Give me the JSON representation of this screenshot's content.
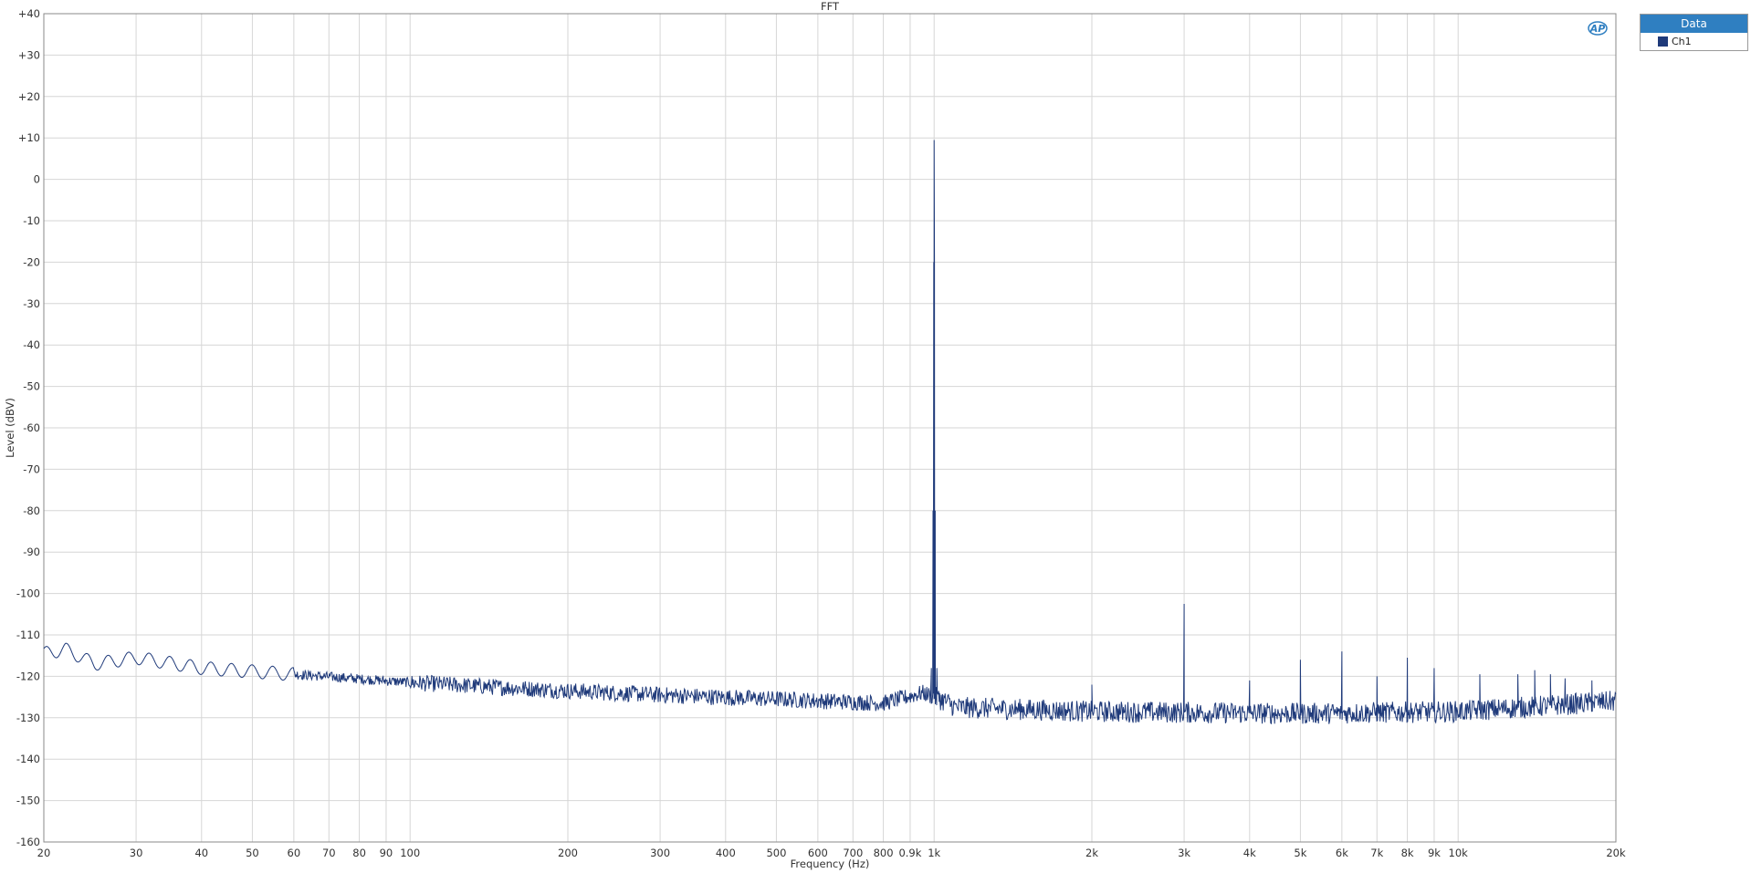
{
  "chart_data": {
    "type": "line",
    "title": "FFT",
    "xlabel": "Frequency (Hz)",
    "ylabel": "Level (dBV)",
    "x_scale": "log",
    "xlim": [
      20,
      20000
    ],
    "ylim": [
      -160,
      40
    ],
    "grid": true,
    "legend": {
      "title": "Data",
      "placement": "top-right-outside"
    },
    "x_ticks": [
      {
        "v": 20,
        "label": "20"
      },
      {
        "v": 30,
        "label": "30"
      },
      {
        "v": 40,
        "label": "40"
      },
      {
        "v": 50,
        "label": "50"
      },
      {
        "v": 60,
        "label": "60"
      },
      {
        "v": 70,
        "label": "70"
      },
      {
        "v": 80,
        "label": "80"
      },
      {
        "v": 90,
        "label": "90"
      },
      {
        "v": 100,
        "label": "100"
      },
      {
        "v": 200,
        "label": "200"
      },
      {
        "v": 300,
        "label": "300"
      },
      {
        "v": 400,
        "label": "400"
      },
      {
        "v": 500,
        "label": "500"
      },
      {
        "v": 600,
        "label": "600"
      },
      {
        "v": 700,
        "label": "700"
      },
      {
        "v": 800,
        "label": "800"
      },
      {
        "v": 900,
        "label": "0.9k"
      },
      {
        "v": 1000,
        "label": "1k"
      },
      {
        "v": 2000,
        "label": "2k"
      },
      {
        "v": 3000,
        "label": "3k"
      },
      {
        "v": 4000,
        "label": "4k"
      },
      {
        "v": 5000,
        "label": "5k"
      },
      {
        "v": 6000,
        "label": "6k"
      },
      {
        "v": 7000,
        "label": "7k"
      },
      {
        "v": 8000,
        "label": "8k"
      },
      {
        "v": 9000,
        "label": "9k"
      },
      {
        "v": 10000,
        "label": "10k"
      },
      {
        "v": 20000,
        "label": "20k"
      }
    ],
    "y_ticks": [
      {
        "v": 40,
        "label": "+40"
      },
      {
        "v": 30,
        "label": "+30"
      },
      {
        "v": 20,
        "label": "+20"
      },
      {
        "v": 10,
        "label": "+10"
      },
      {
        "v": 0,
        "label": "0"
      },
      {
        "v": -10,
        "label": "-10"
      },
      {
        "v": -20,
        "label": "-20"
      },
      {
        "v": -30,
        "label": "-30"
      },
      {
        "v": -40,
        "label": "-40"
      },
      {
        "v": -50,
        "label": "-50"
      },
      {
        "v": -60,
        "label": "-60"
      },
      {
        "v": -70,
        "label": "-70"
      },
      {
        "v": -80,
        "label": "-80"
      },
      {
        "v": -90,
        "label": "-90"
      },
      {
        "v": -100,
        "label": "-100"
      },
      {
        "v": -110,
        "label": "-110"
      },
      {
        "v": -120,
        "label": "-120"
      },
      {
        "v": -130,
        "label": "-130"
      },
      {
        "v": -140,
        "label": "-140"
      },
      {
        "v": -150,
        "label": "-150"
      },
      {
        "v": -160,
        "label": "-160"
      }
    ],
    "series": [
      {
        "name": "Ch1",
        "color": "#1f3a7a",
        "noise_floor": [
          [
            20,
            -114.5
          ],
          [
            22,
            -113.5
          ],
          [
            25,
            -117
          ],
          [
            30,
            -115.5
          ],
          [
            40,
            -118
          ],
          [
            60,
            -119.5
          ],
          [
            100,
            -121.5
          ],
          [
            200,
            -123.5
          ],
          [
            300,
            -124.5
          ],
          [
            500,
            -125.5
          ],
          [
            800,
            -126.5
          ],
          [
            950,
            -124
          ],
          [
            1050,
            -126
          ],
          [
            1100,
            -127.5
          ],
          [
            2000,
            -128.5
          ],
          [
            5000,
            -129
          ],
          [
            10000,
            -128.5
          ],
          [
            20000,
            -126
          ]
        ],
        "peaks": [
          {
            "x": 1000,
            "y": 9.5
          },
          {
            "x": 2000,
            "y": -122
          },
          {
            "x": 3000,
            "y": -102.5
          },
          {
            "x": 4000,
            "y": -121
          },
          {
            "x": 5000,
            "y": -116
          },
          {
            "x": 6000,
            "y": -114
          },
          {
            "x": 7000,
            "y": -120
          },
          {
            "x": 8000,
            "y": -115.5
          },
          {
            "x": 9000,
            "y": -118
          },
          {
            "x": 11000,
            "y": -119.5
          },
          {
            "x": 13000,
            "y": -119.5
          },
          {
            "x": 14000,
            "y": -118.5
          },
          {
            "x": 15000,
            "y": -119.5
          },
          {
            "x": 16000,
            "y": -120.5
          },
          {
            "x": 18000,
            "y": -121
          }
        ]
      }
    ]
  },
  "logo": {
    "text": "AP",
    "color": "#2f7fc1"
  },
  "legend_title": "Data",
  "legend_color": "#2f7fc1"
}
